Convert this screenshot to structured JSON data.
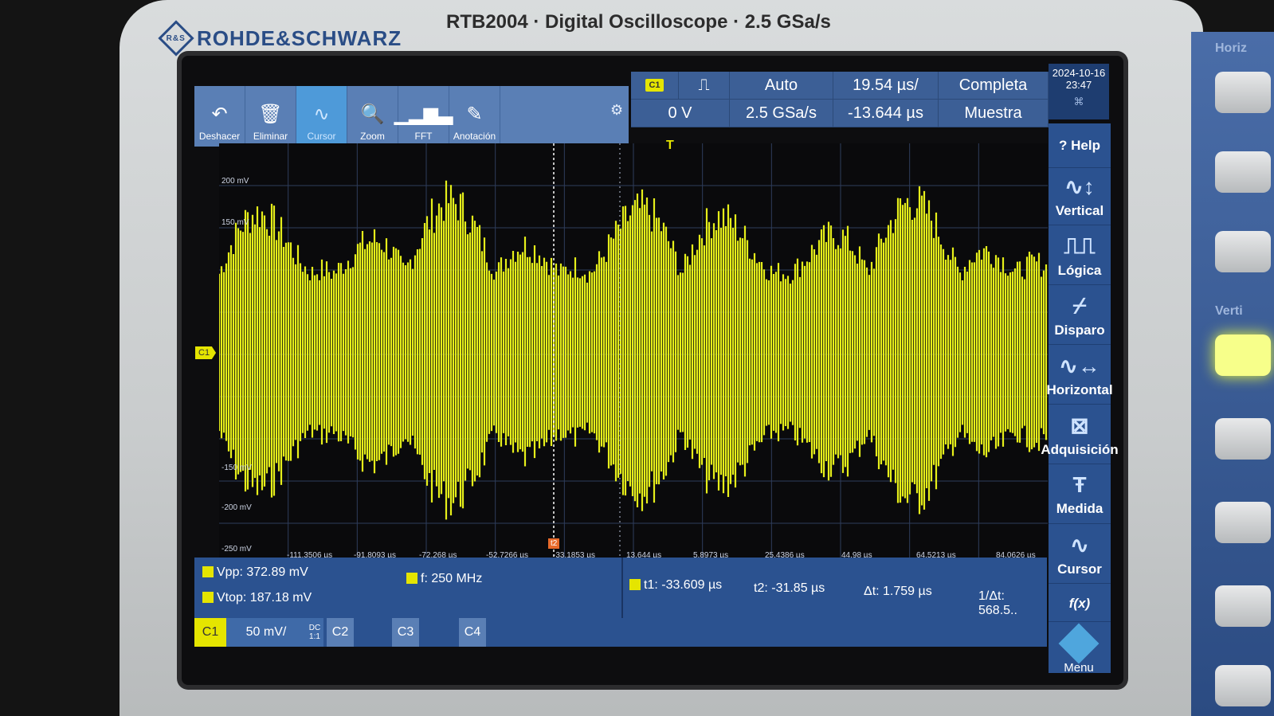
{
  "device": {
    "brand": "ROHDE&SCHWARZ",
    "model_line": "RTB2004 · Digital Oscilloscope · 2.5 GSa/s"
  },
  "toolbar": {
    "tools": [
      {
        "label": "Deshacer",
        "icon": "undo-icon"
      },
      {
        "label": "Eliminar",
        "icon": "trash-icon"
      },
      {
        "label": "Cursor",
        "icon": "cursor-wave-icon"
      },
      {
        "label": "Zoom",
        "icon": "zoom-icon"
      },
      {
        "label": "FFT",
        "icon": "fft-icon"
      },
      {
        "label": "Anotación",
        "icon": "pencil-icon"
      }
    ]
  },
  "trigger": {
    "source": "C1",
    "level": "0 V",
    "mode": "Auto",
    "sample_rate": "2.5 GSa/s",
    "timebase": "19.54 µs/",
    "offset": "-13.644 µs",
    "acquire_mode": "Completa",
    "record": "Muestra"
  },
  "datetime": {
    "date": "2024-10-16",
    "time": "23:47"
  },
  "grid": {
    "y_labels": [
      "200 mV",
      "150 mV",
      "-150 mV",
      "-200 mV",
      "-250 mV"
    ],
    "x_labels": [
      "-111.3506 µs",
      "-91.8093 µs",
      "-72.268 µs",
      "-52.7266 µs",
      "-33.1853 µs",
      "13.644 µs",
      "5.8973 µs",
      "25.4386 µs",
      "44.98 µs",
      "64.5213 µs",
      "84.0626 µs"
    ],
    "channel_marker": "C1",
    "trigger_marker": "T",
    "cursor_marker": "t2",
    "trace_color": "#e6ef1a"
  },
  "sidebar": {
    "items": [
      {
        "label": "Help",
        "icon": "help-icon"
      },
      {
        "label": "Vertical",
        "icon": "vertical-icon"
      },
      {
        "label": "Lógica",
        "icon": "logic-icon"
      },
      {
        "label": "Disparo",
        "icon": "trigger-icon"
      },
      {
        "label": "Horizontal",
        "icon": "horizontal-icon"
      },
      {
        "label": "Adquisición",
        "icon": "acquisition-icon"
      },
      {
        "label": "Medida",
        "icon": "measure-icon"
      },
      {
        "label": "Cursor",
        "icon": "cursor-icon"
      },
      {
        "label": "f(x)",
        "icon": "function-icon"
      }
    ],
    "menu_label": "Menu"
  },
  "measurements": {
    "vpp": "Vpp: 372.89 mV",
    "vtop": "Vtop: 187.18 mV",
    "freq": "f: 250 MHz",
    "t1": "t1: -33.609 µs",
    "t2": "t2: -31.85 µs",
    "dt": "Δt: 1.759 µs",
    "inv_dt": "1/Δt: 568.5.."
  },
  "channels": {
    "c1": "C1",
    "c1_scale": "50 mV/",
    "c1_coupling": "DC",
    "c1_ratio": "1:1",
    "c2": "C2",
    "c3": "C3",
    "c4": "C4"
  },
  "front_panel": {
    "horiz_label": "Horiz",
    "vert_label": "Verti"
  }
}
